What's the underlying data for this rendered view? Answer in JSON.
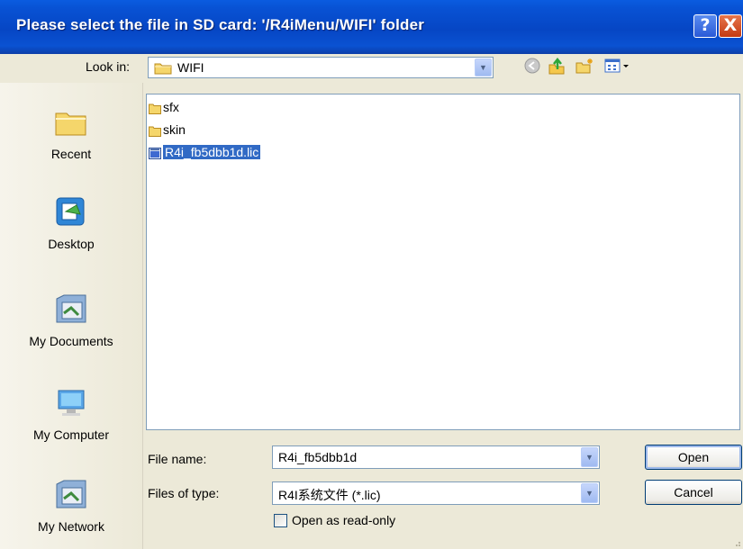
{
  "window": {
    "title": "Please select the file in SD card: '/R4iMenu/WIFI' folder",
    "help_glyph": "?",
    "close_glyph": "X"
  },
  "look_in": {
    "label": "Look in:",
    "value": "WIFI"
  },
  "toolbar": {
    "icons": [
      "back-icon",
      "up-folder-icon",
      "new-folder-icon",
      "view-menu-icon"
    ]
  },
  "places": [
    {
      "label": "Recent",
      "icon": "recent-icon"
    },
    {
      "label": "Desktop",
      "icon": "desktop-icon"
    },
    {
      "label": "My Documents",
      "icon": "my-documents-icon"
    },
    {
      "label": "My Computer",
      "icon": "my-computer-icon"
    },
    {
      "label": "My Network",
      "icon": "my-network-icon"
    }
  ],
  "files": [
    {
      "name": "sfx",
      "type": "folder",
      "selected": false
    },
    {
      "name": "skin",
      "type": "folder",
      "selected": false
    },
    {
      "name": "R4i_fb5dbb1d.lic",
      "type": "file",
      "selected": true
    }
  ],
  "form": {
    "file_name_label": "File name:",
    "file_name_value": "R4i_fb5dbb1d",
    "file_type_label": "Files of type:",
    "file_type_value": "R4I系统文件 (*.lic)",
    "readonly_label": "Open as read-only",
    "readonly_checked": false
  },
  "buttons": {
    "open": "Open",
    "cancel": "Cancel"
  },
  "colors": {
    "title_bar": "#0646C4",
    "selection": "#316AC5",
    "dialog_bg": "#ECE9D8"
  }
}
